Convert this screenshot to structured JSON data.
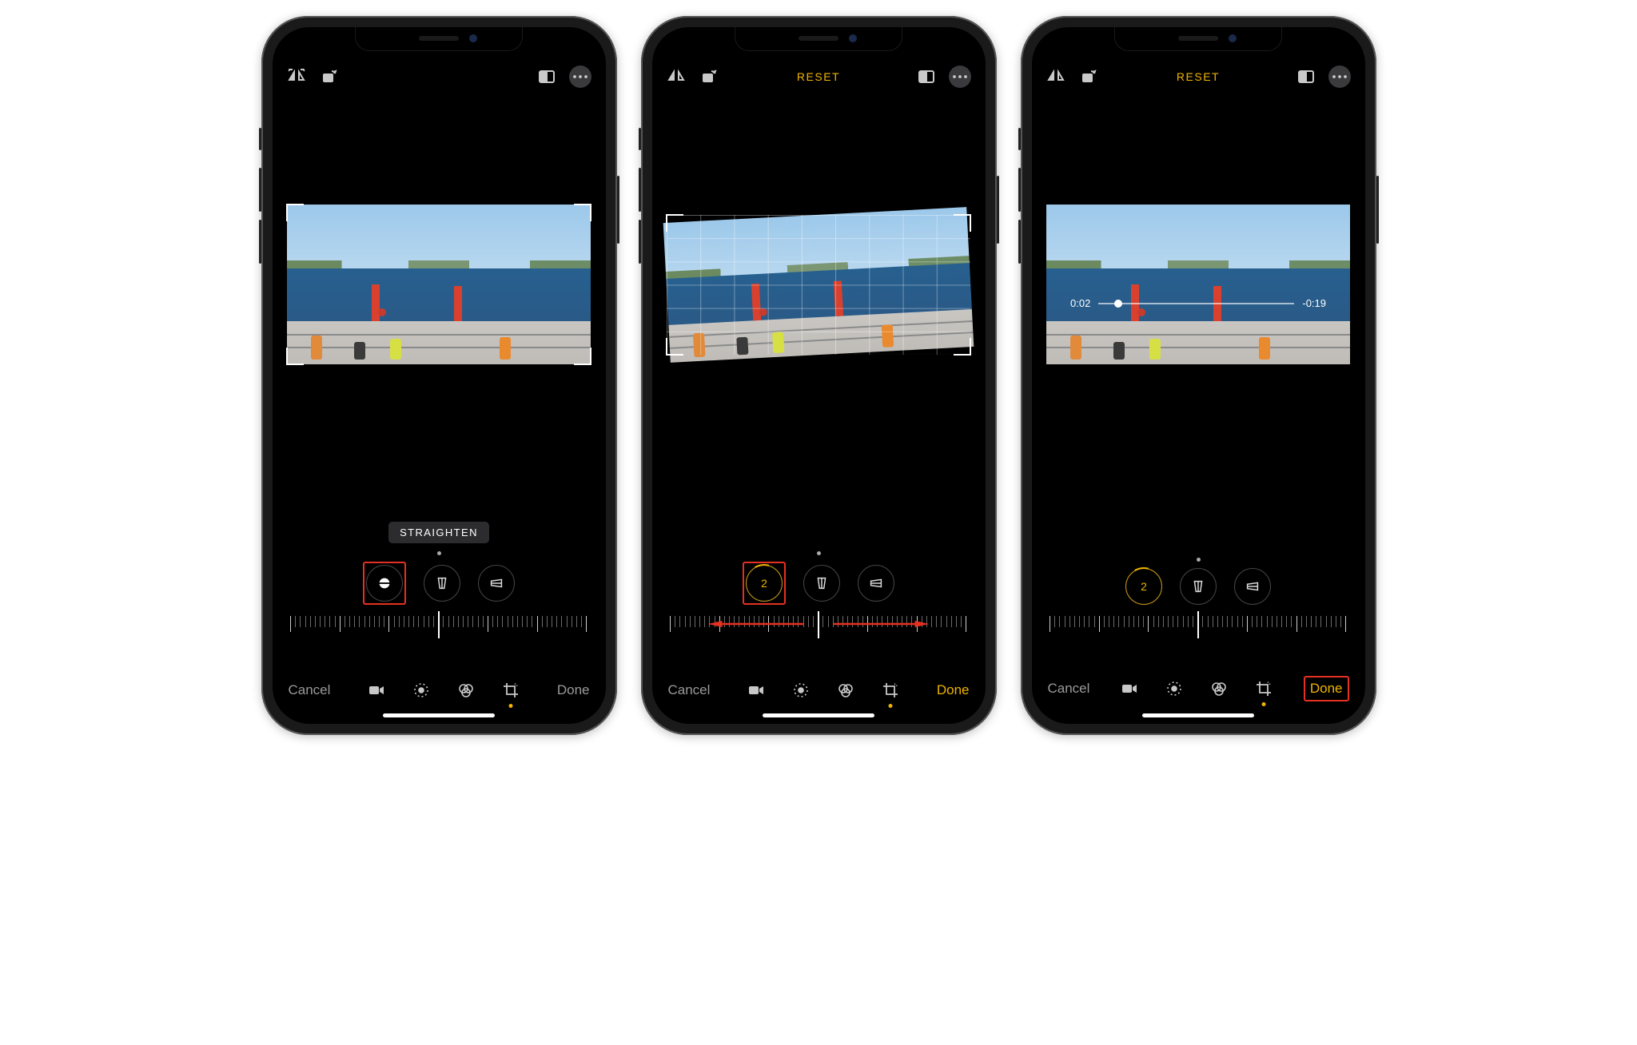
{
  "screens": [
    {
      "topbar": {
        "reset_label": null
      },
      "straighten_label": "STRAIGHTEN",
      "straighten_value": null,
      "show_grid": false,
      "show_label_pill": true,
      "highlight_tool": "straighten",
      "ruler_arrows": false,
      "tilted": false,
      "scrub": null,
      "bottom": {
        "cancel": "Cancel",
        "done": "Done",
        "done_accent": false,
        "done_boxed": false
      }
    },
    {
      "topbar": {
        "reset_label": "RESET"
      },
      "straighten_label": null,
      "straighten_value": "2",
      "show_grid": true,
      "show_label_pill": false,
      "highlight_tool": "straighten_value",
      "ruler_arrows": true,
      "tilted": true,
      "scrub": null,
      "bottom": {
        "cancel": "Cancel",
        "done": "Done",
        "done_accent": true,
        "done_boxed": false
      }
    },
    {
      "topbar": {
        "reset_label": "RESET"
      },
      "straighten_label": null,
      "straighten_value": "2",
      "show_grid": false,
      "show_label_pill": false,
      "highlight_tool": null,
      "ruler_arrows": false,
      "tilted": false,
      "scrub": {
        "current": "0:02",
        "remaining": "-0:19"
      },
      "bottom": {
        "cancel": "Cancel",
        "done": "Done",
        "done_accent": true,
        "done_boxed": true
      }
    }
  ],
  "icons": {
    "flip": "flip-horizontal-icon",
    "rotate": "rotate-icon",
    "aspect": "aspect-icon",
    "more": "more-icon",
    "straighten": "straighten-icon",
    "skew_h": "skew-horizontal-icon",
    "skew_v": "skew-vertical-icon",
    "video": "video-mode-icon",
    "adjust": "adjust-mode-icon",
    "filters": "filters-mode-icon",
    "crop": "crop-mode-icon"
  }
}
